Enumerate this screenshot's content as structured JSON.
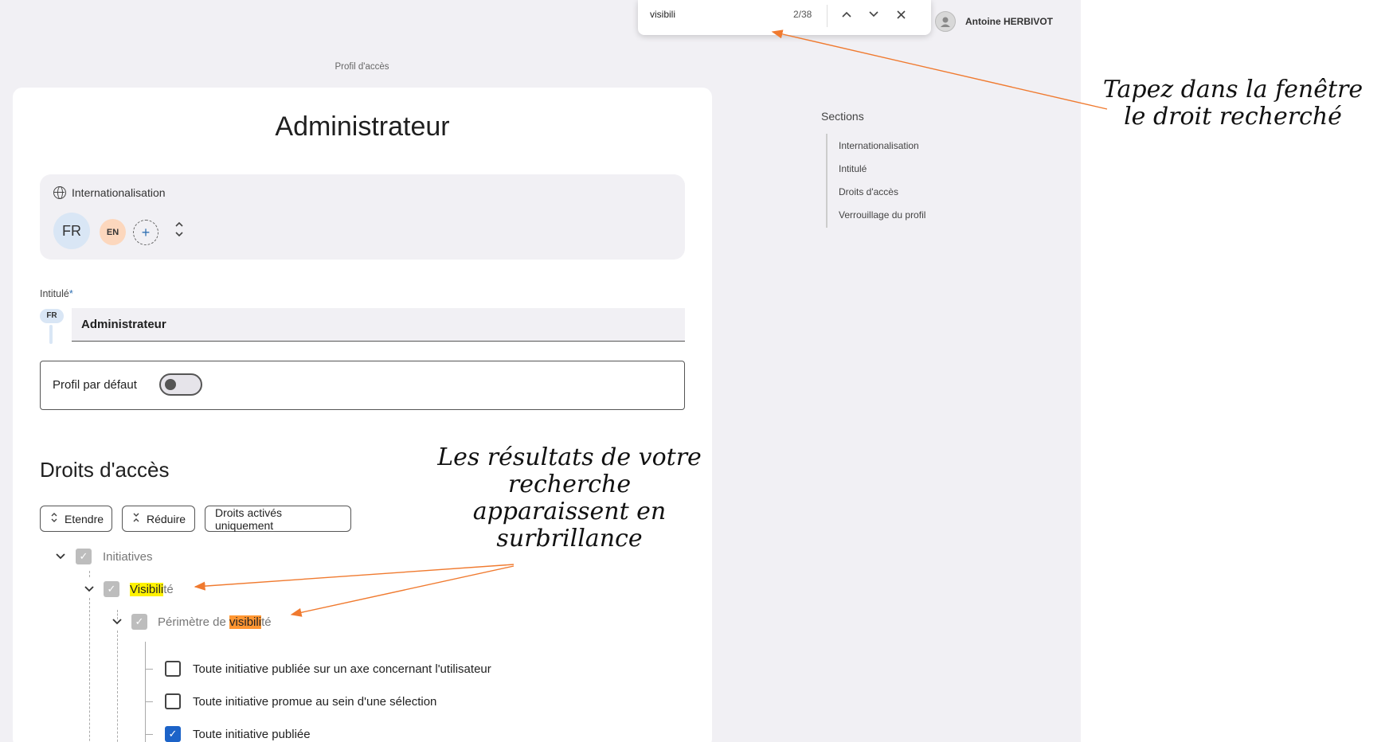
{
  "find_bar": {
    "query": "visibili",
    "count": "2/38"
  },
  "user": {
    "name": "Antoine HERBIVOT"
  },
  "breadcrumb": "Profil d'accès",
  "page_title": "Administrateur",
  "internationalisation": {
    "title": "Internationalisation",
    "lang_fr": "FR",
    "lang_en": "EN",
    "add_label": "+"
  },
  "intitule": {
    "label": "Intitulé",
    "required_mark": "*",
    "lang_badge": "FR",
    "value": "Administrateur"
  },
  "default_profile": {
    "label": "Profil par défaut",
    "enabled": false
  },
  "droits": {
    "title": "Droits d'accès",
    "buttons": {
      "expand": "Etendre",
      "collapse": "Réduire",
      "active_only": "Droits activés uniquement"
    },
    "tree": {
      "root": "Initiatives",
      "child_match": "Visibili",
      "child_rest": "té",
      "grand_prefix": "Périmètre de ",
      "grand_match": "visibili",
      "grand_rest": "té",
      "leaves": [
        {
          "label": "Toute initiative publiée sur un axe concernant l'utilisateur",
          "checked": false
        },
        {
          "label": "Toute initiative promue au sein d'une sélection",
          "checked": false
        },
        {
          "label": "Toute initiative publiée",
          "checked": true
        }
      ]
    }
  },
  "sections": {
    "title": "Sections",
    "items": [
      "Internationalisation",
      "Intitulé",
      "Droits d'accès",
      "Verrouillage du profil"
    ]
  },
  "callouts": {
    "top": "Tapez dans la fenêtre le droit recherché",
    "middle": "Les résultats de votre recherche apparaissent en surbrillance"
  },
  "colors": {
    "accent": "#1c63c8",
    "highlight_current": "#ff9632",
    "highlight_other": "#fff200",
    "arrow": "#f07a2f"
  },
  "icons": [
    "globe-icon",
    "chevron-up-icon",
    "chevron-down-icon",
    "close-icon",
    "expand-icon",
    "collapse-icon",
    "check-icon"
  ]
}
